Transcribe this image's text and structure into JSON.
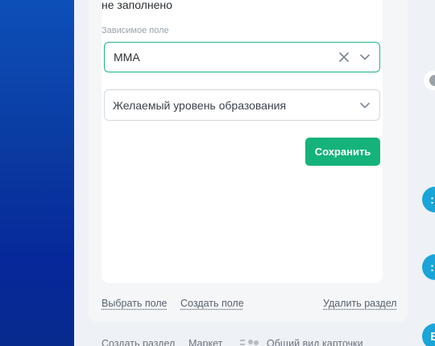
{
  "form": {
    "status_text": "не заполнено",
    "dependent_label": "Зависимое поле",
    "dependent_value": "MMA",
    "education_placeholder": "Желаемый уровень образования",
    "save_label": "Сохранить"
  },
  "footer": {
    "choose_field": "Выбрать поле",
    "create_field": "Создать поле",
    "delete_section": "Удалить раздел"
  },
  "bottom_bar": {
    "create_section": "Создать раздел",
    "market": "Маркет",
    "common_view": "Общий вид карточки"
  },
  "colors": {
    "accent": "#15b37b",
    "sidebar_gradient_top": "#0d4fb8",
    "sidebar_gradient_bottom": "#062a8e",
    "right_action": "#1aa4d8"
  }
}
